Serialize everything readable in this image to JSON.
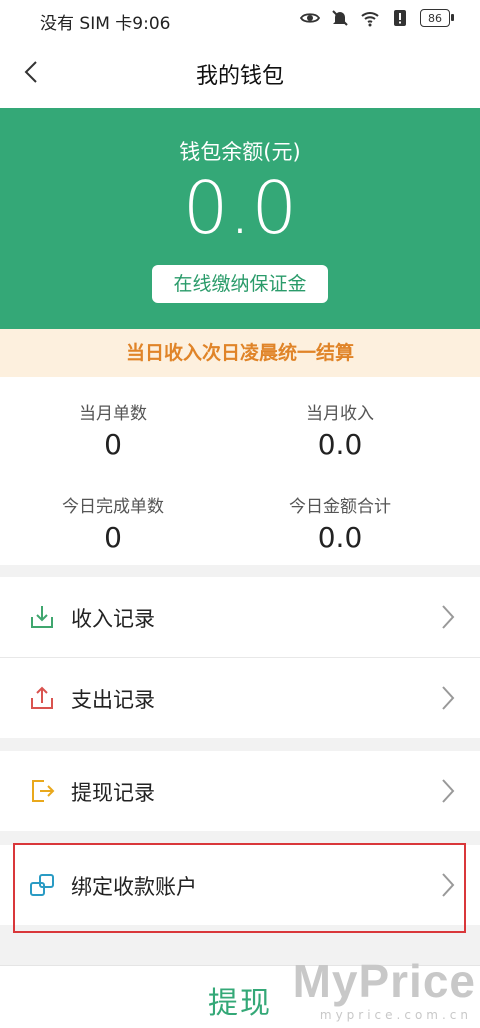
{
  "status_bar": {
    "carrier_time": "没有 SIM 卡9:06",
    "battery": "86"
  },
  "nav": {
    "title": "我的钱包"
  },
  "wallet": {
    "balance_label": "钱包余额(元)",
    "balance_value": "0.0",
    "deposit_button": "在线缴纳保证金"
  },
  "notice": "当日收入次日凌晨统一结算",
  "stats": [
    {
      "label": "当月单数",
      "value": "0"
    },
    {
      "label": "当月收入",
      "value": "0.0"
    },
    {
      "label": "今日完成单数",
      "value": "0"
    },
    {
      "label": "今日金额合计",
      "value": "0.0"
    }
  ],
  "menu": {
    "income": {
      "label": "收入记录",
      "icon": "download-tray-icon",
      "color": "#3fa66e"
    },
    "expense": {
      "label": "支出记录",
      "icon": "upload-tray-icon",
      "color": "#d9534f"
    },
    "withdraw_records": {
      "label": "提现记录",
      "icon": "exit-arrow-icon",
      "color": "#e9a81c"
    },
    "bind_account": {
      "label": "绑定收款账户",
      "icon": "link-squares-icon",
      "color": "#2a9bc4"
    }
  },
  "bottom": {
    "withdraw_button": "提现"
  },
  "watermark": {
    "brand": "MyPrice",
    "site": "myprice.com.cn"
  },
  "colors": {
    "primary": "#34a877",
    "notice_bg": "#fdf0de",
    "notice_text": "#e08428",
    "highlight": "#d9373a"
  }
}
